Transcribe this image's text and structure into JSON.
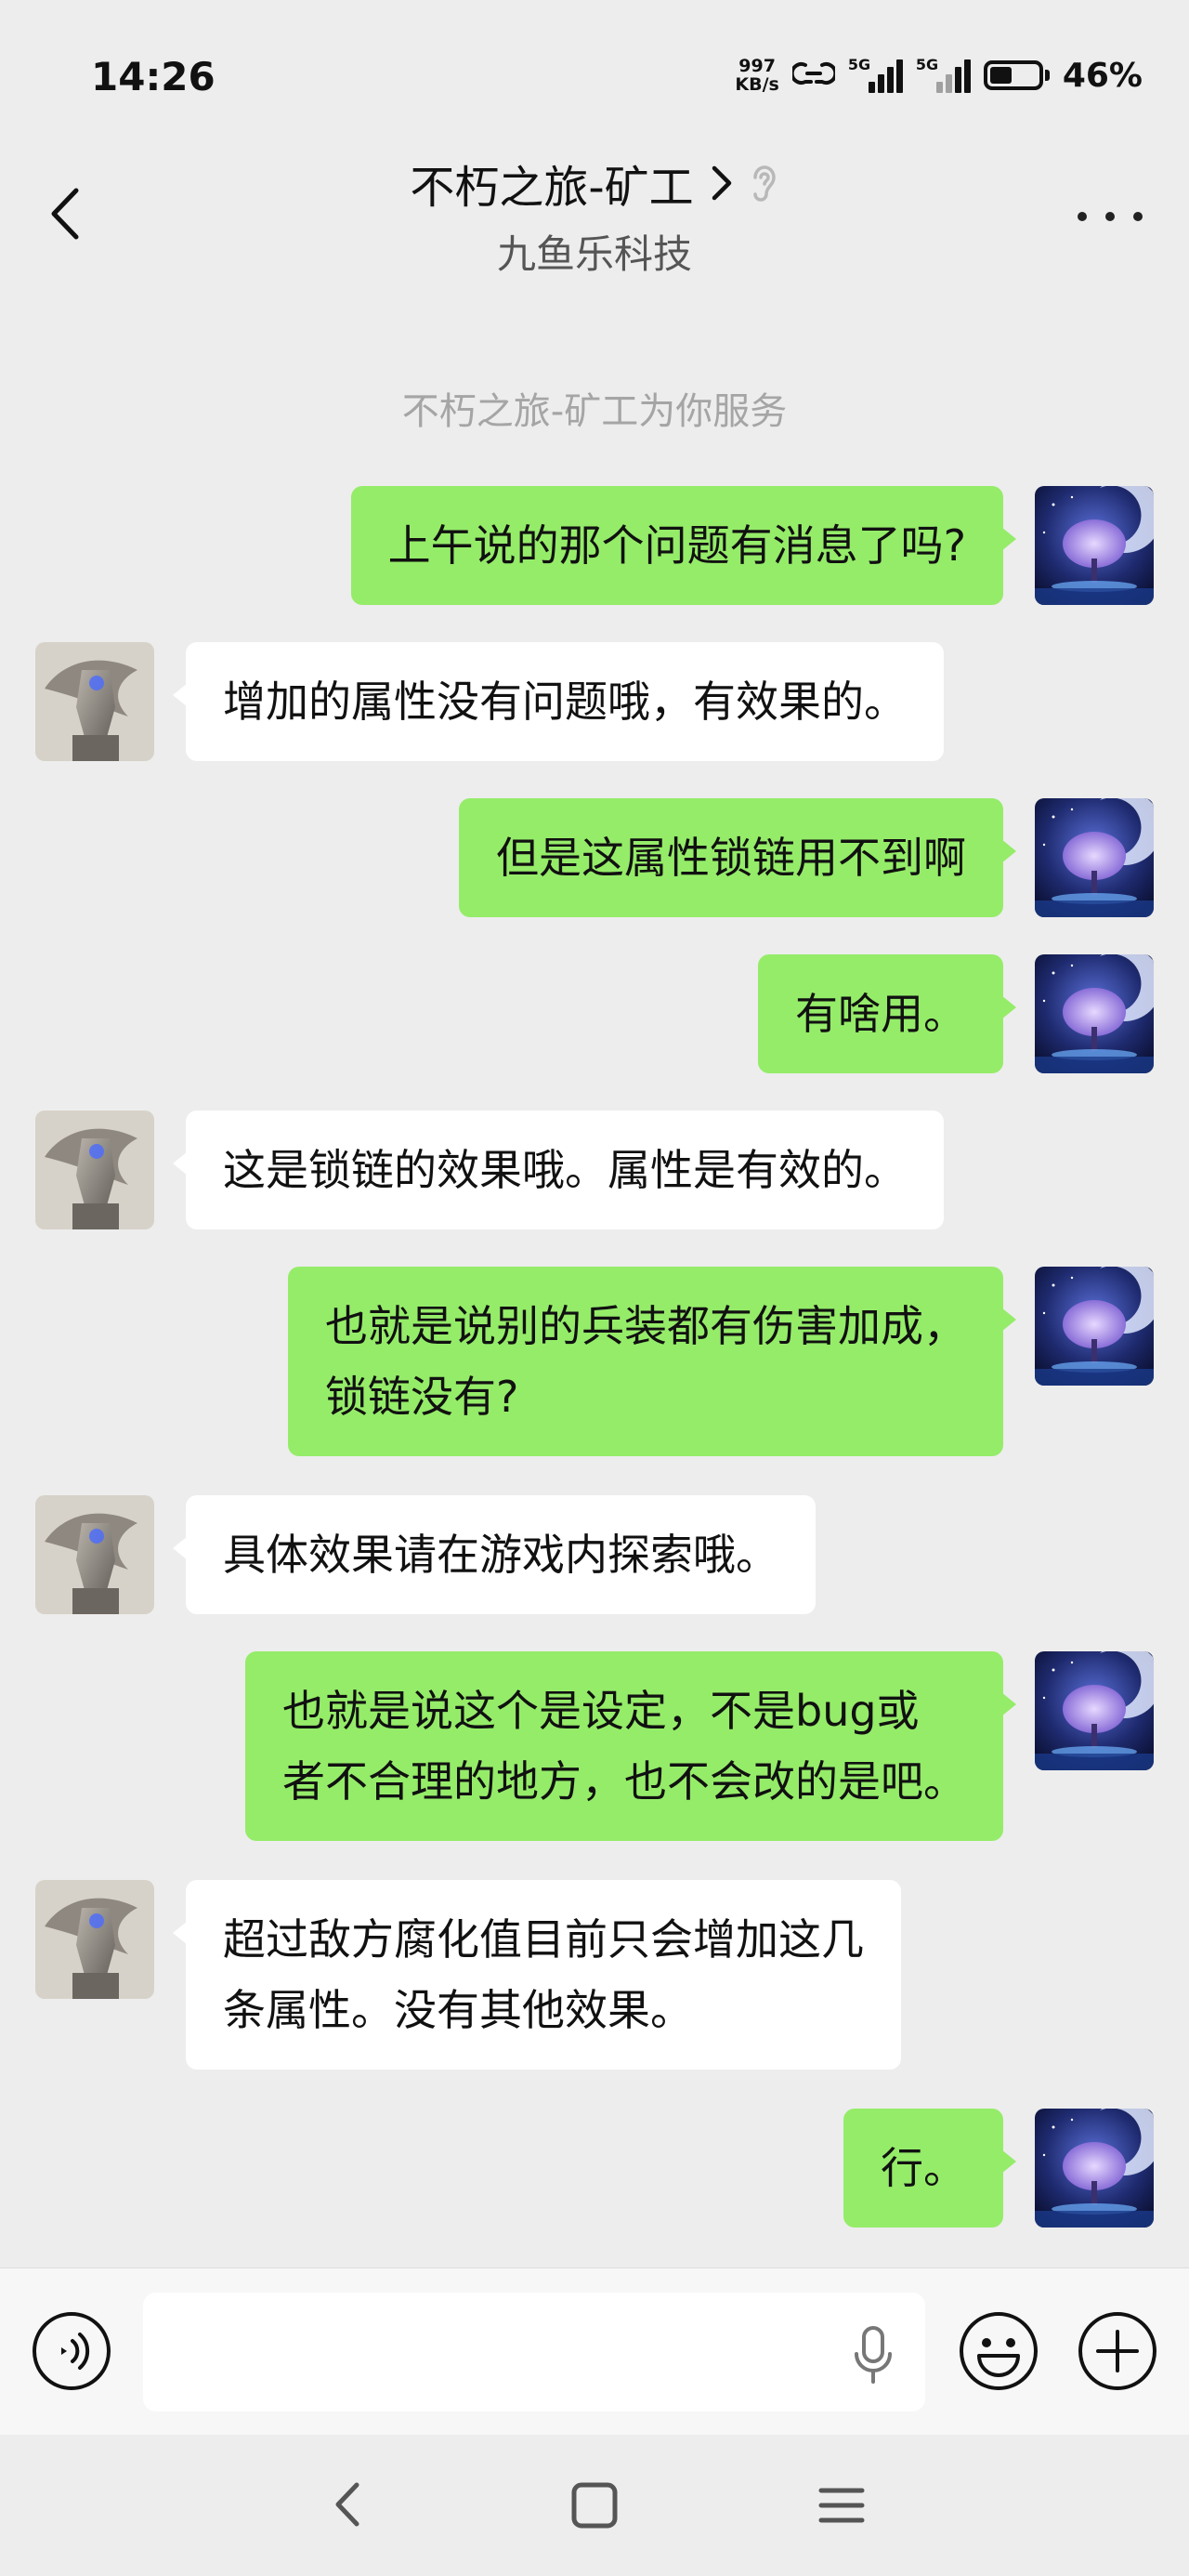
{
  "status_bar": {
    "time": "14:26",
    "net_speed_value": "997",
    "net_speed_unit": "KB/s",
    "sim1_label": "5G",
    "sim2_label": "5G",
    "battery_percent": "46%",
    "battery_level": 0.46
  },
  "header": {
    "title": "不朽之旅-矿工",
    "subtitle": "九鱼乐科技"
  },
  "service_notice": "不朽之旅-矿工为你服务",
  "messages": [
    {
      "side": "right",
      "text": "上午说的那个问题有消息了吗?"
    },
    {
      "side": "left",
      "text": "增加的属性没有问题哦，有效果的。"
    },
    {
      "side": "right",
      "text": "但是这属性锁链用不到啊"
    },
    {
      "side": "right",
      "text": "有啥用。"
    },
    {
      "side": "left",
      "text": "这是锁链的效果哦。属性是有效的。"
    },
    {
      "side": "right",
      "text": "也就是说别的兵装都有伤害加成，\n锁链没有?"
    },
    {
      "side": "left",
      "text": "具体效果请在游戏内探索哦。"
    },
    {
      "side": "right",
      "text": "也就是说这个是设定，不是bug或\n者不合理的地方，也不会改的是吧。"
    },
    {
      "side": "left",
      "text": "超过敌方腐化值目前只会增加这几\n条属性。没有其他效果。"
    },
    {
      "side": "right",
      "text": "行。"
    }
  ],
  "input": {
    "value": "",
    "placeholder": ""
  },
  "icons": {
    "voice": "voice-mode-icon",
    "mic": "microphone-icon",
    "emoji": "emoji-icon",
    "plus": "plus-icon",
    "back": "chevron-left-icon",
    "more": "more-dots-icon"
  },
  "colors": {
    "background": "#ededed",
    "sent_bubble": "#95ec69",
    "received_bubble": "#ffffff",
    "notice_text": "#a5a5a5"
  }
}
